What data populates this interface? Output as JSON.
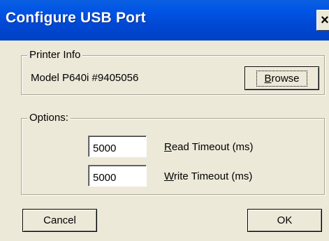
{
  "window": {
    "title": "Configure USB Port",
    "close_label": "×"
  },
  "printer_info": {
    "legend": "Printer Info",
    "model_text": "Model P640i #9405056",
    "browse_button": {
      "mnemonic": "B",
      "rest": "rowse"
    }
  },
  "options": {
    "legend": "Options:",
    "read_timeout": {
      "value": "5000",
      "label_mnemonic": "R",
      "label_rest": "ead Timeout (ms)"
    },
    "write_timeout": {
      "value": "5000",
      "label_mnemonic": "W",
      "label_rest": "rite Timeout (ms)"
    }
  },
  "footer": {
    "cancel_label": "Cancel",
    "ok_label": "OK"
  }
}
